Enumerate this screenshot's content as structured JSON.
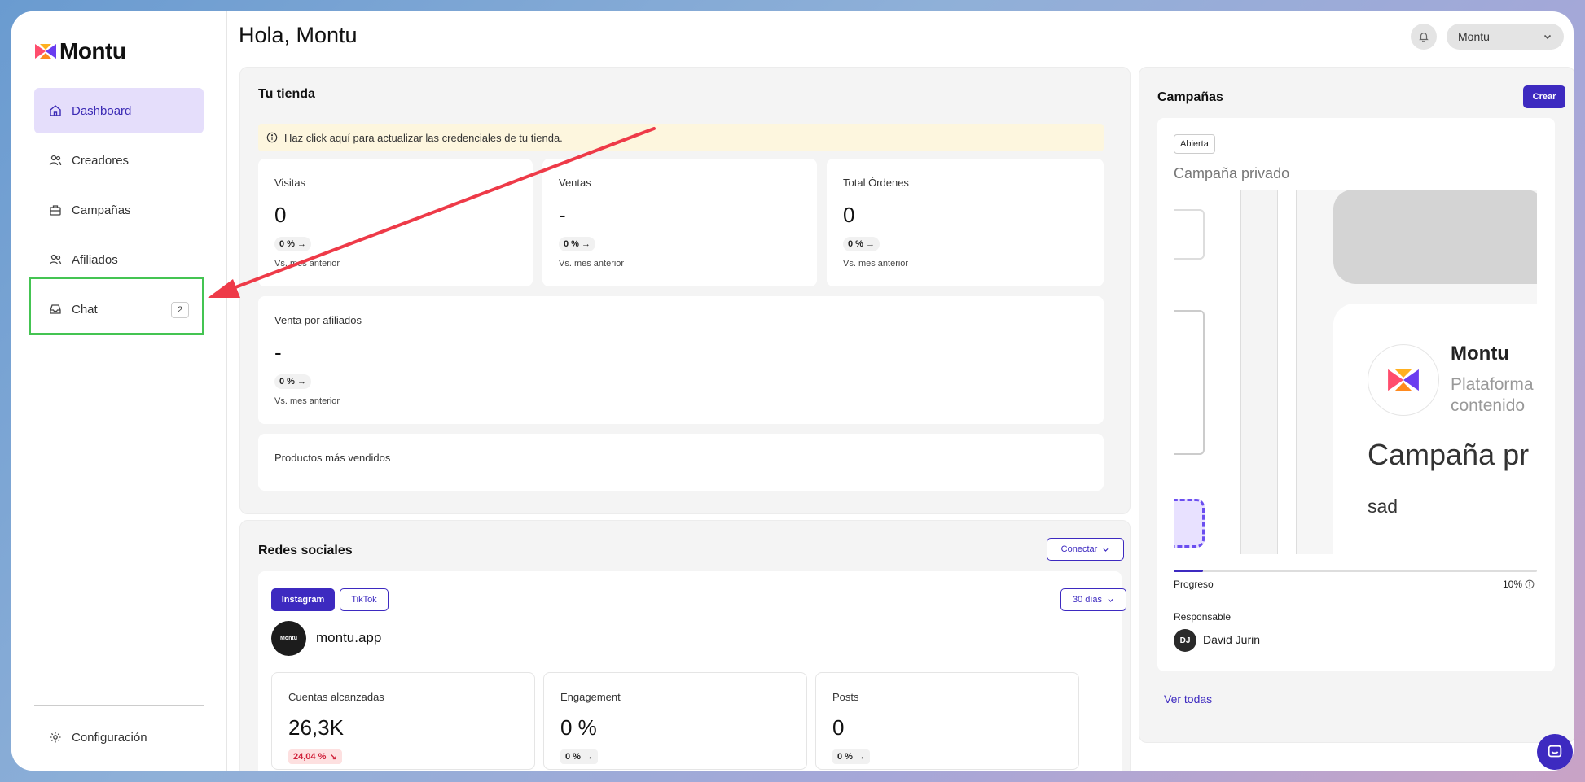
{
  "app": {
    "logo_text": "Montu"
  },
  "sidebar": {
    "items": [
      {
        "label": "Dashboard",
        "icon": "home-icon"
      },
      {
        "label": "Creadores",
        "icon": "users-icon"
      },
      {
        "label": "Campañas",
        "icon": "briefcase-icon"
      },
      {
        "label": "Afiliados",
        "icon": "users-icon"
      },
      {
        "label": "Chat",
        "icon": "inbox-icon",
        "badge": "2"
      }
    ],
    "settings_label": "Configuración"
  },
  "header": {
    "greeting": "Hola, Montu",
    "user_name": "Montu"
  },
  "store": {
    "title": "Tu tienda",
    "alert": "Haz click aquí para actualizar las credenciales de tu tienda.",
    "metrics": [
      {
        "label": "Visitas",
        "value": "0",
        "change": "0 %",
        "compare": "Vs. mes anterior"
      },
      {
        "label": "Ventas",
        "value": "-",
        "change": "0 %",
        "compare": "Vs. mes anterior"
      },
      {
        "label": "Total Órdenes",
        "value": "0",
        "change": "0 %",
        "compare": "Vs. mes anterior"
      }
    ],
    "affiliates": {
      "label": "Venta por afiliados",
      "value": "-",
      "change": "0 %",
      "compare": "Vs. mes anterior"
    },
    "top_products_label": "Productos más vendidos"
  },
  "social": {
    "title": "Redes sociales",
    "connect_label": "Conectar",
    "tabs": [
      "Instagram",
      "TikTok"
    ],
    "period_label": "30 días",
    "account_name": "montu.app",
    "avatar_text": "Montu",
    "stats": [
      {
        "label": "Cuentas alcanzadas",
        "value": "26,3K",
        "change": "24,04 %"
      },
      {
        "label": "Engagement",
        "value": "0 %",
        "change": "0 %"
      },
      {
        "label": "Posts",
        "value": "0",
        "change": "0 %"
      }
    ]
  },
  "campaigns": {
    "title": "Campañas",
    "create_label": "Crear",
    "status_tag": "Abierta",
    "campaign_name": "Campaña privado",
    "preview": {
      "brand": "Montu",
      "subtitle_line1": "Plataforma",
      "subtitle_line2": "contenido",
      "heading": "Campaña pr",
      "body": "sad"
    },
    "progress_label": "Progreso",
    "progress_value": "10%",
    "progress_fraction": 0.08,
    "responsible_label": "Responsable",
    "responsible_initials": "DJ",
    "responsible_name": "David Jurin",
    "see_all_label": "Ver todas"
  },
  "colors": {
    "accent": "#3d2ac0",
    "highlight": "#44c452",
    "arrow": "#ee3a48"
  }
}
